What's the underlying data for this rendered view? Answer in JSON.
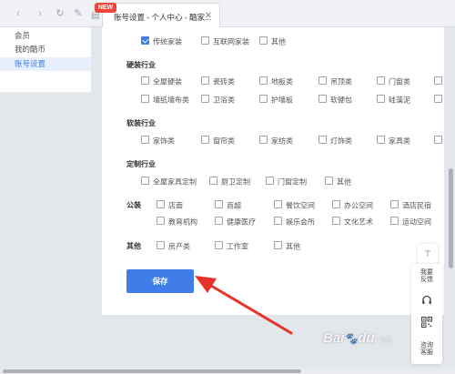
{
  "browser": {
    "back_glyph": "‹",
    "forward_glyph": "›",
    "refresh_glyph": "↻",
    "pin_glyph": "✎",
    "bag_glyph": "▤",
    "new_badge": "NEW",
    "tab_title": "账号设置 - 个人中心 - 酷家...",
    "tab_close": "✕"
  },
  "sidebar": {
    "items": [
      {
        "label": "会员",
        "active": false
      },
      {
        "label": "我的酷币",
        "active": false
      },
      {
        "label": "账号设置",
        "active": true
      }
    ]
  },
  "industries": {
    "top_row": [
      "传统家装",
      "互联网家装",
      "其他"
    ],
    "hard": {
      "title": "硬装行业",
      "row1": [
        "全屋硬装",
        "瓷砖类",
        "地板类",
        "吊顶类",
        "门窗类",
        "浴"
      ],
      "row2": [
        "墙纸墙布类",
        "卫浴类",
        "护墙板",
        "软硬包",
        "硅藻泥",
        "其"
      ]
    },
    "soft": {
      "title": "软装行业",
      "row1": [
        "家饰类",
        "窗帘类",
        "家纺类",
        "灯饰类",
        "家具类",
        "其"
      ]
    },
    "custom": {
      "title": "定制行业",
      "row1": [
        "全屋家具定制",
        "厨卫定制",
        "门窗定制",
        "其他"
      ]
    },
    "public": {
      "label": "公装",
      "row1": [
        "店面",
        "商超",
        "餐饮空间",
        "办公空间",
        "酒店民宿"
      ],
      "row2": [
        "教育机构",
        "健康医疗",
        "娱乐会所",
        "文化艺术",
        "运动空间"
      ]
    },
    "other": {
      "label": "其他",
      "row1": [
        "房产类",
        "工作室",
        "其他"
      ]
    }
  },
  "save_label": "保存",
  "float_panel": {
    "top_glyph": "⊤",
    "feedback": [
      "我要",
      "反馈"
    ],
    "consult": [
      "咨询",
      "客服"
    ]
  },
  "watermark": {
    "main": "Bai",
    "du": "du",
    "sub": "经验"
  },
  "colors": {
    "accent": "#3f7de8",
    "arrow": "#e8332b",
    "badge": "#f0453a"
  }
}
